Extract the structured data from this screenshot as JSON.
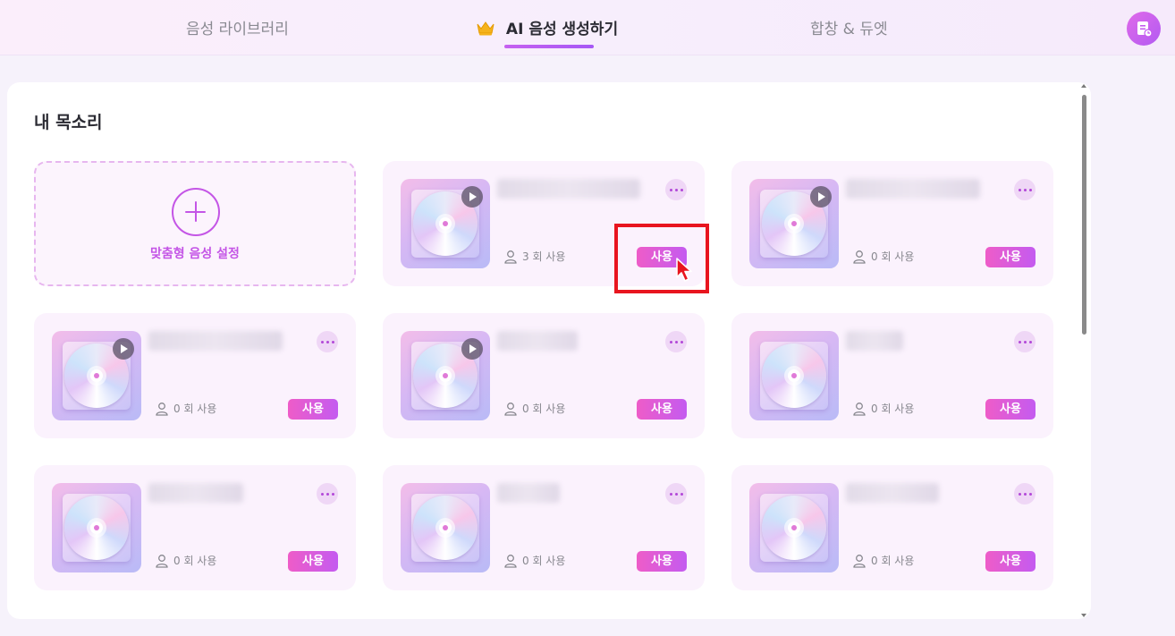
{
  "tabs": [
    {
      "label": "음성 라이브러리"
    },
    {
      "label": "AI 음성 생성하기"
    },
    {
      "label": "합창 & 듀엣"
    }
  ],
  "colors": {
    "accent": "#c455e6",
    "highlight": "#e8151f"
  },
  "section_title": "내 목소리",
  "custom_voice": {
    "label": "맞춤형 음성 설정"
  },
  "voices": [
    {
      "uses": "3 회 사용",
      "button": "사용"
    },
    {
      "uses": "0 회 사용",
      "button": "사용"
    },
    {
      "uses": "0 회 사용",
      "button": "사용"
    },
    {
      "uses": "0 회 사용",
      "button": "사용"
    },
    {
      "uses": "0 회 사용",
      "button": "사용"
    },
    {
      "uses": "0 회 사용",
      "button": "사용"
    },
    {
      "uses": "0 회 사용",
      "button": "사용"
    },
    {
      "uses": "0 회 사용",
      "button": "사용"
    }
  ],
  "icons": [
    "crown-icon",
    "profile-list-icon",
    "plus-icon",
    "play-icon",
    "more-icon",
    "person-icon",
    "cursor-icon"
  ]
}
